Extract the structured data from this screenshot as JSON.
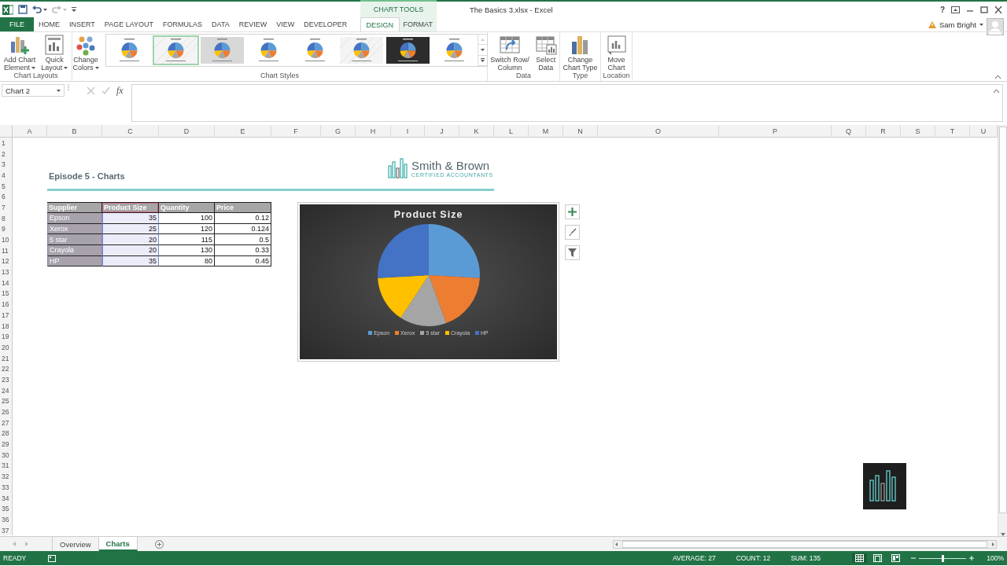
{
  "window": {
    "title": "The Basics 3.xlsx - Excel",
    "help": "?"
  },
  "quick_access": [
    {
      "kind": "save",
      "disabled": false
    },
    {
      "kind": "undo",
      "disabled": false
    },
    {
      "kind": "redo",
      "disabled": true
    },
    {
      "kind": "customize",
      "disabled": false
    }
  ],
  "user": {
    "name": "Sam Bright"
  },
  "tabs": [
    {
      "label": "FILE",
      "kind": "file",
      "selected": false
    },
    {
      "label": "HOME",
      "kind": "normal",
      "selected": false
    },
    {
      "label": "INSERT",
      "kind": "normal",
      "selected": false
    },
    {
      "label": "PAGE LAYOUT",
      "kind": "normal",
      "selected": false
    },
    {
      "label": "FORMULAS",
      "kind": "normal",
      "selected": false
    },
    {
      "label": "DATA",
      "kind": "normal",
      "selected": false
    },
    {
      "label": "REVIEW",
      "kind": "normal",
      "selected": false
    },
    {
      "label": "VIEW",
      "kind": "normal",
      "selected": false
    },
    {
      "label": "DEVELOPER",
      "kind": "normal",
      "selected": false
    }
  ],
  "context_tabs": {
    "label": "CHART TOOLS",
    "tabs": [
      {
        "label": "DESIGN",
        "selected": true
      },
      {
        "label": "FORMAT",
        "selected": false
      }
    ]
  },
  "ribbon": {
    "groups": [
      {
        "label": "Chart Layouts",
        "buttons": [
          {
            "kind": "add_element",
            "lines": [
              "Add Chart",
              "Element"
            ],
            "dropdown": true
          },
          {
            "kind": "quick_layout",
            "lines": [
              "Quick",
              "Layout"
            ],
            "dropdown": true
          }
        ]
      },
      {
        "label": "Chart Styles",
        "buttons": [
          {
            "kind": "change_colors",
            "lines": [
              "Change",
              "Colors"
            ],
            "dropdown": true
          }
        ],
        "gallery": [
          {
            "kind": "white",
            "selected": false
          },
          {
            "kind": "hatched",
            "selected": true
          },
          {
            "kind": "gray",
            "selected": false
          },
          {
            "kind": "white",
            "selected": false
          },
          {
            "kind": "white",
            "selected": false
          },
          {
            "kind": "hatched",
            "selected": false
          },
          {
            "kind": "dark",
            "selected": false
          },
          {
            "kind": "white",
            "selected": false
          }
        ]
      },
      {
        "label": "Data",
        "buttons": [
          {
            "kind": "switch",
            "lines": [
              "Switch Row/",
              "Column"
            ],
            "dropdown": false
          },
          {
            "kind": "select_data",
            "lines": [
              "Select",
              "Data"
            ],
            "dropdown": false
          }
        ]
      },
      {
        "label": "Type",
        "buttons": [
          {
            "kind": "change_type",
            "lines": [
              "Change",
              "Chart Type"
            ],
            "dropdown": false
          }
        ]
      },
      {
        "label": "Location",
        "buttons": [
          {
            "kind": "move_chart",
            "lines": [
              "Move",
              "Chart"
            ],
            "dropdown": false
          }
        ]
      }
    ]
  },
  "formula_bar": {
    "name_box": "Chart 2",
    "buttons": [
      {
        "kind": "cancel",
        "disabled": true
      },
      {
        "kind": "enter",
        "disabled": true
      }
    ],
    "fx": "fx"
  },
  "sheet": {
    "columns": [
      "A",
      "B",
      "C",
      "D",
      "E",
      "F",
      "G",
      "H",
      "I",
      "J",
      "K",
      "L",
      "M",
      "N",
      "O",
      "P",
      "Q",
      "R",
      "S",
      "T",
      "U"
    ],
    "rows": [
      "1",
      "2",
      "3",
      "4",
      "5",
      "6",
      "7",
      "8",
      "9",
      "10",
      "11",
      "12",
      "13",
      "14",
      "15",
      "16",
      "17",
      "18",
      "19",
      "20",
      "21",
      "22",
      "23",
      "24",
      "25",
      "26",
      "27",
      "28",
      "29",
      "30",
      "31",
      "32",
      "33",
      "34",
      "35",
      "36",
      "37"
    ],
    "heading": "Episode 5 - Charts",
    "logo": {
      "name": "Smith & Brown",
      "tagline": "CERTIFIED ACCOUNTANTS"
    },
    "table": {
      "columns": [
        {
          "label": "Supplier",
          "kind": "categories"
        },
        {
          "label": "Product Size",
          "kind": "values"
        },
        {
          "label": "Quantity",
          "kind": "plain"
        },
        {
          "label": "Price",
          "kind": "plain"
        }
      ],
      "rows": [
        [
          "Epson",
          "35",
          "100",
          "0.12"
        ],
        [
          "Xerox",
          "25",
          "120",
          "0.124"
        ],
        [
          "5 star",
          "20",
          "115",
          "0.5"
        ],
        [
          "Crayola",
          "20",
          "130",
          "0.33"
        ],
        [
          "HP",
          "35",
          "80",
          "0.45"
        ]
      ]
    },
    "chart": {
      "chart_data": {
        "type": "pie",
        "title": "Product Size",
        "categories": [
          "Epson",
          "Xerox",
          "5 star",
          "Crayola",
          "HP"
        ],
        "values": [
          25.93,
          18.52,
          14.81,
          14.81,
          25.93
        ],
        "legend": "bottom"
      },
      "buttons": [
        {
          "kind": "add"
        },
        {
          "kind": "style"
        },
        {
          "kind": "filter"
        }
      ]
    }
  },
  "sheet_tabs": [
    {
      "label": "Overview",
      "selected": false
    },
    {
      "label": "Charts",
      "selected": true
    }
  ],
  "status_bar": {
    "status": "READY",
    "stats": [
      "AVERAGE: 27",
      "COUNT: 12",
      "SUM: 135"
    ],
    "views": [
      {
        "kind": "normal",
        "selected": true
      },
      {
        "kind": "page_layout",
        "selected": false
      },
      {
        "kind": "page_break",
        "selected": false
      }
    ],
    "zoom": {
      "level": 0.5,
      "reading": "100%"
    }
  }
}
